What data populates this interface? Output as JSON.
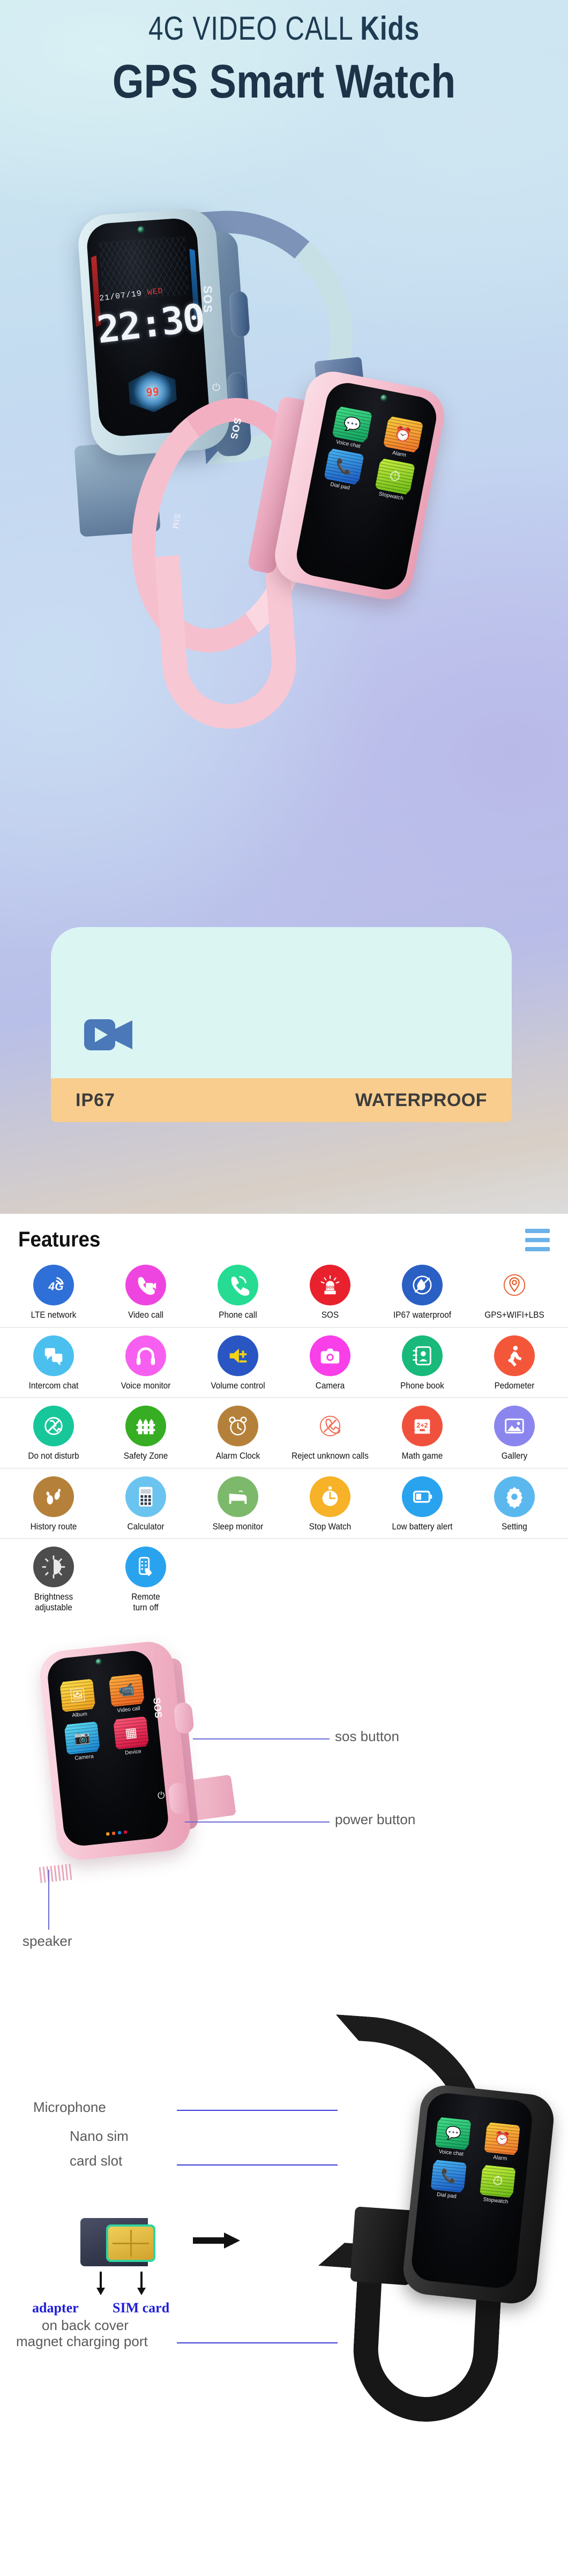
{
  "hero": {
    "title_line1_light": "4G VIDEO CALL ",
    "title_line1_bold": "Kids",
    "title_line2": "GPS Smart Watch",
    "blue_watch": {
      "date": "21/07/19 ",
      "date_day": "WED",
      "time": "22:30",
      "badge_value": "99",
      "sos_label": "SOS",
      "power_glyph": "⏻"
    },
    "pink_watch": {
      "sos_label": "SOS",
      "sim_label": "SIM",
      "apps": [
        {
          "label": "Voice chat",
          "color": "green",
          "glyph": "💬"
        },
        {
          "label": "Alarm",
          "color": "orange",
          "glyph": "⏰"
        },
        {
          "label": "Dial pad",
          "color": "blue",
          "glyph": "📞"
        },
        {
          "label": "Stopwatch",
          "color": "lime",
          "glyph": "⏱"
        }
      ]
    },
    "ip_card": {
      "video_icon": "video-camera-icon",
      "ip_rating": "IP67",
      "waterproof": "WATERPROOF",
      "bar_color": "#f8cd8e",
      "card_color": "#dbf5f3"
    }
  },
  "features": {
    "title": "Features",
    "menu_icon": "hamburger-menu-icon",
    "accent_color": "#6ab2e8",
    "rows": [
      [
        {
          "label": "LTE network",
          "icon": "lte-network-icon",
          "color": "#2f6fd8",
          "glyph": "4G"
        },
        {
          "label": "Video call",
          "icon": "video-call-icon",
          "color": "#ef45e0",
          "glyph": "📹"
        },
        {
          "label": "Phone call",
          "icon": "phone-call-icon",
          "color": "#25dc92",
          "glyph": "📞"
        },
        {
          "label": "SOS",
          "icon": "sos-siren-icon",
          "color": "#e8212d",
          "glyph": "SOS"
        },
        {
          "label": "IP67 waterproof",
          "icon": "waterproof-icon",
          "color": "#2a5fc4",
          "glyph": "💧"
        },
        {
          "label": "GPS+WIFI+LBS",
          "icon": "gps-pin-icon",
          "color": "#ffffff",
          "glyph": "📍"
        }
      ],
      [
        {
          "label": "Intercom chat",
          "icon": "chat-bubbles-icon",
          "color": "#4bc0ef",
          "glyph": "💬"
        },
        {
          "label": "Voice monitor",
          "icon": "headphones-icon",
          "color": "#f75ff0",
          "glyph": "🎧"
        },
        {
          "label": "Volume control",
          "icon": "volume-icon",
          "color": "#2a56c4",
          "glyph": "🔊"
        },
        {
          "label": "Camera",
          "icon": "camera-icon",
          "color": "#f93fe8",
          "glyph": "📷"
        },
        {
          "label": "Phone book",
          "icon": "phone-book-icon",
          "color": "#18b97a",
          "glyph": "📒"
        },
        {
          "label": "Pedometer",
          "icon": "pedometer-icon",
          "color": "#f4563a",
          "glyph": "🏃"
        }
      ],
      [
        {
          "label": "Do not disturb",
          "icon": "do-not-disturb-icon",
          "color": "#17c79a",
          "glyph": "🚫"
        },
        {
          "label": "Safety Zone",
          "icon": "safety-zone-fence-icon",
          "color": "#36ad22",
          "glyph": "🚧"
        },
        {
          "label": "Alarm Clock",
          "icon": "alarm-clock-icon",
          "color": "#b5813a",
          "glyph": "⏰"
        },
        {
          "label": "Reject unknown calls",
          "icon": "reject-call-icon",
          "color": "#ffffff",
          "glyph": "📵"
        },
        {
          "label": "Math game",
          "icon": "math-game-icon",
          "color": "#f0513c",
          "glyph": "2+2"
        },
        {
          "label": "Gallery",
          "icon": "gallery-icon",
          "color": "#8b86ee",
          "glyph": "🖼"
        }
      ],
      [
        {
          "label": "History route",
          "icon": "footprints-icon",
          "color": "#b5813a",
          "glyph": "👣"
        },
        {
          "label": "Calculator",
          "icon": "calculator-icon",
          "color": "#6ac4ef",
          "glyph": "🧮"
        },
        {
          "label": "Sleep monitor",
          "icon": "sleep-bed-icon",
          "color": "#7cb96a",
          "glyph": "🛏"
        },
        {
          "label": "Stop Watch",
          "icon": "stopwatch-icon",
          "color": "#f7b227",
          "glyph": "⏱"
        },
        {
          "label": "Low battery alert",
          "icon": "battery-icon",
          "color": "#2aa3ef",
          "glyph": "🔋"
        },
        {
          "label": "Setting",
          "icon": "gear-icon",
          "color": "#5bb8ef",
          "glyph": "⚙"
        }
      ],
      [
        {
          "label": "Brightness\nadjustable",
          "icon": "brightness-icon",
          "color": "#4d4d4d",
          "glyph": "◑"
        },
        {
          "label": "Remote\nturn off",
          "icon": "remote-turn-off-icon",
          "color": "#2aa3ef",
          "glyph": "📱"
        }
      ]
    ]
  },
  "pink_callout": {
    "apps": [
      {
        "label": "Album",
        "color": "yellow",
        "glyph": "🖼"
      },
      {
        "label": "Video call",
        "color": "orange",
        "glyph": "📹"
      },
      {
        "label": "Camera",
        "color": "cyan",
        "glyph": "📷"
      },
      {
        "label": "Device",
        "color": "red",
        "glyph": "▦"
      }
    ],
    "sos_side_label": "SOS",
    "power_glyph": "⏻",
    "labels": {
      "sos_button": "sos button",
      "power_button": "power button",
      "speaker": "speaker"
    },
    "line_color": "#6b6bd6"
  },
  "black_callout": {
    "apps": [
      {
        "label": "Voice chat",
        "color": "green",
        "glyph": "💬"
      },
      {
        "label": "Alarm",
        "color": "orange",
        "glyph": "⏰"
      },
      {
        "label": "Dial pad",
        "color": "blue",
        "glyph": "📞"
      },
      {
        "label": "Stopwatch",
        "color": "lime",
        "glyph": "⏱"
      }
    ],
    "labels": {
      "microphone": "Microphone",
      "nano_sim_line1": "Nano sim",
      "nano_sim_line2": "card slot",
      "adapter": "adapter",
      "sim_card": "SIM card",
      "on_back_cover": "on back cover",
      "magnet_port": "magnet charging port"
    },
    "line_color": "#3a3ad8"
  }
}
